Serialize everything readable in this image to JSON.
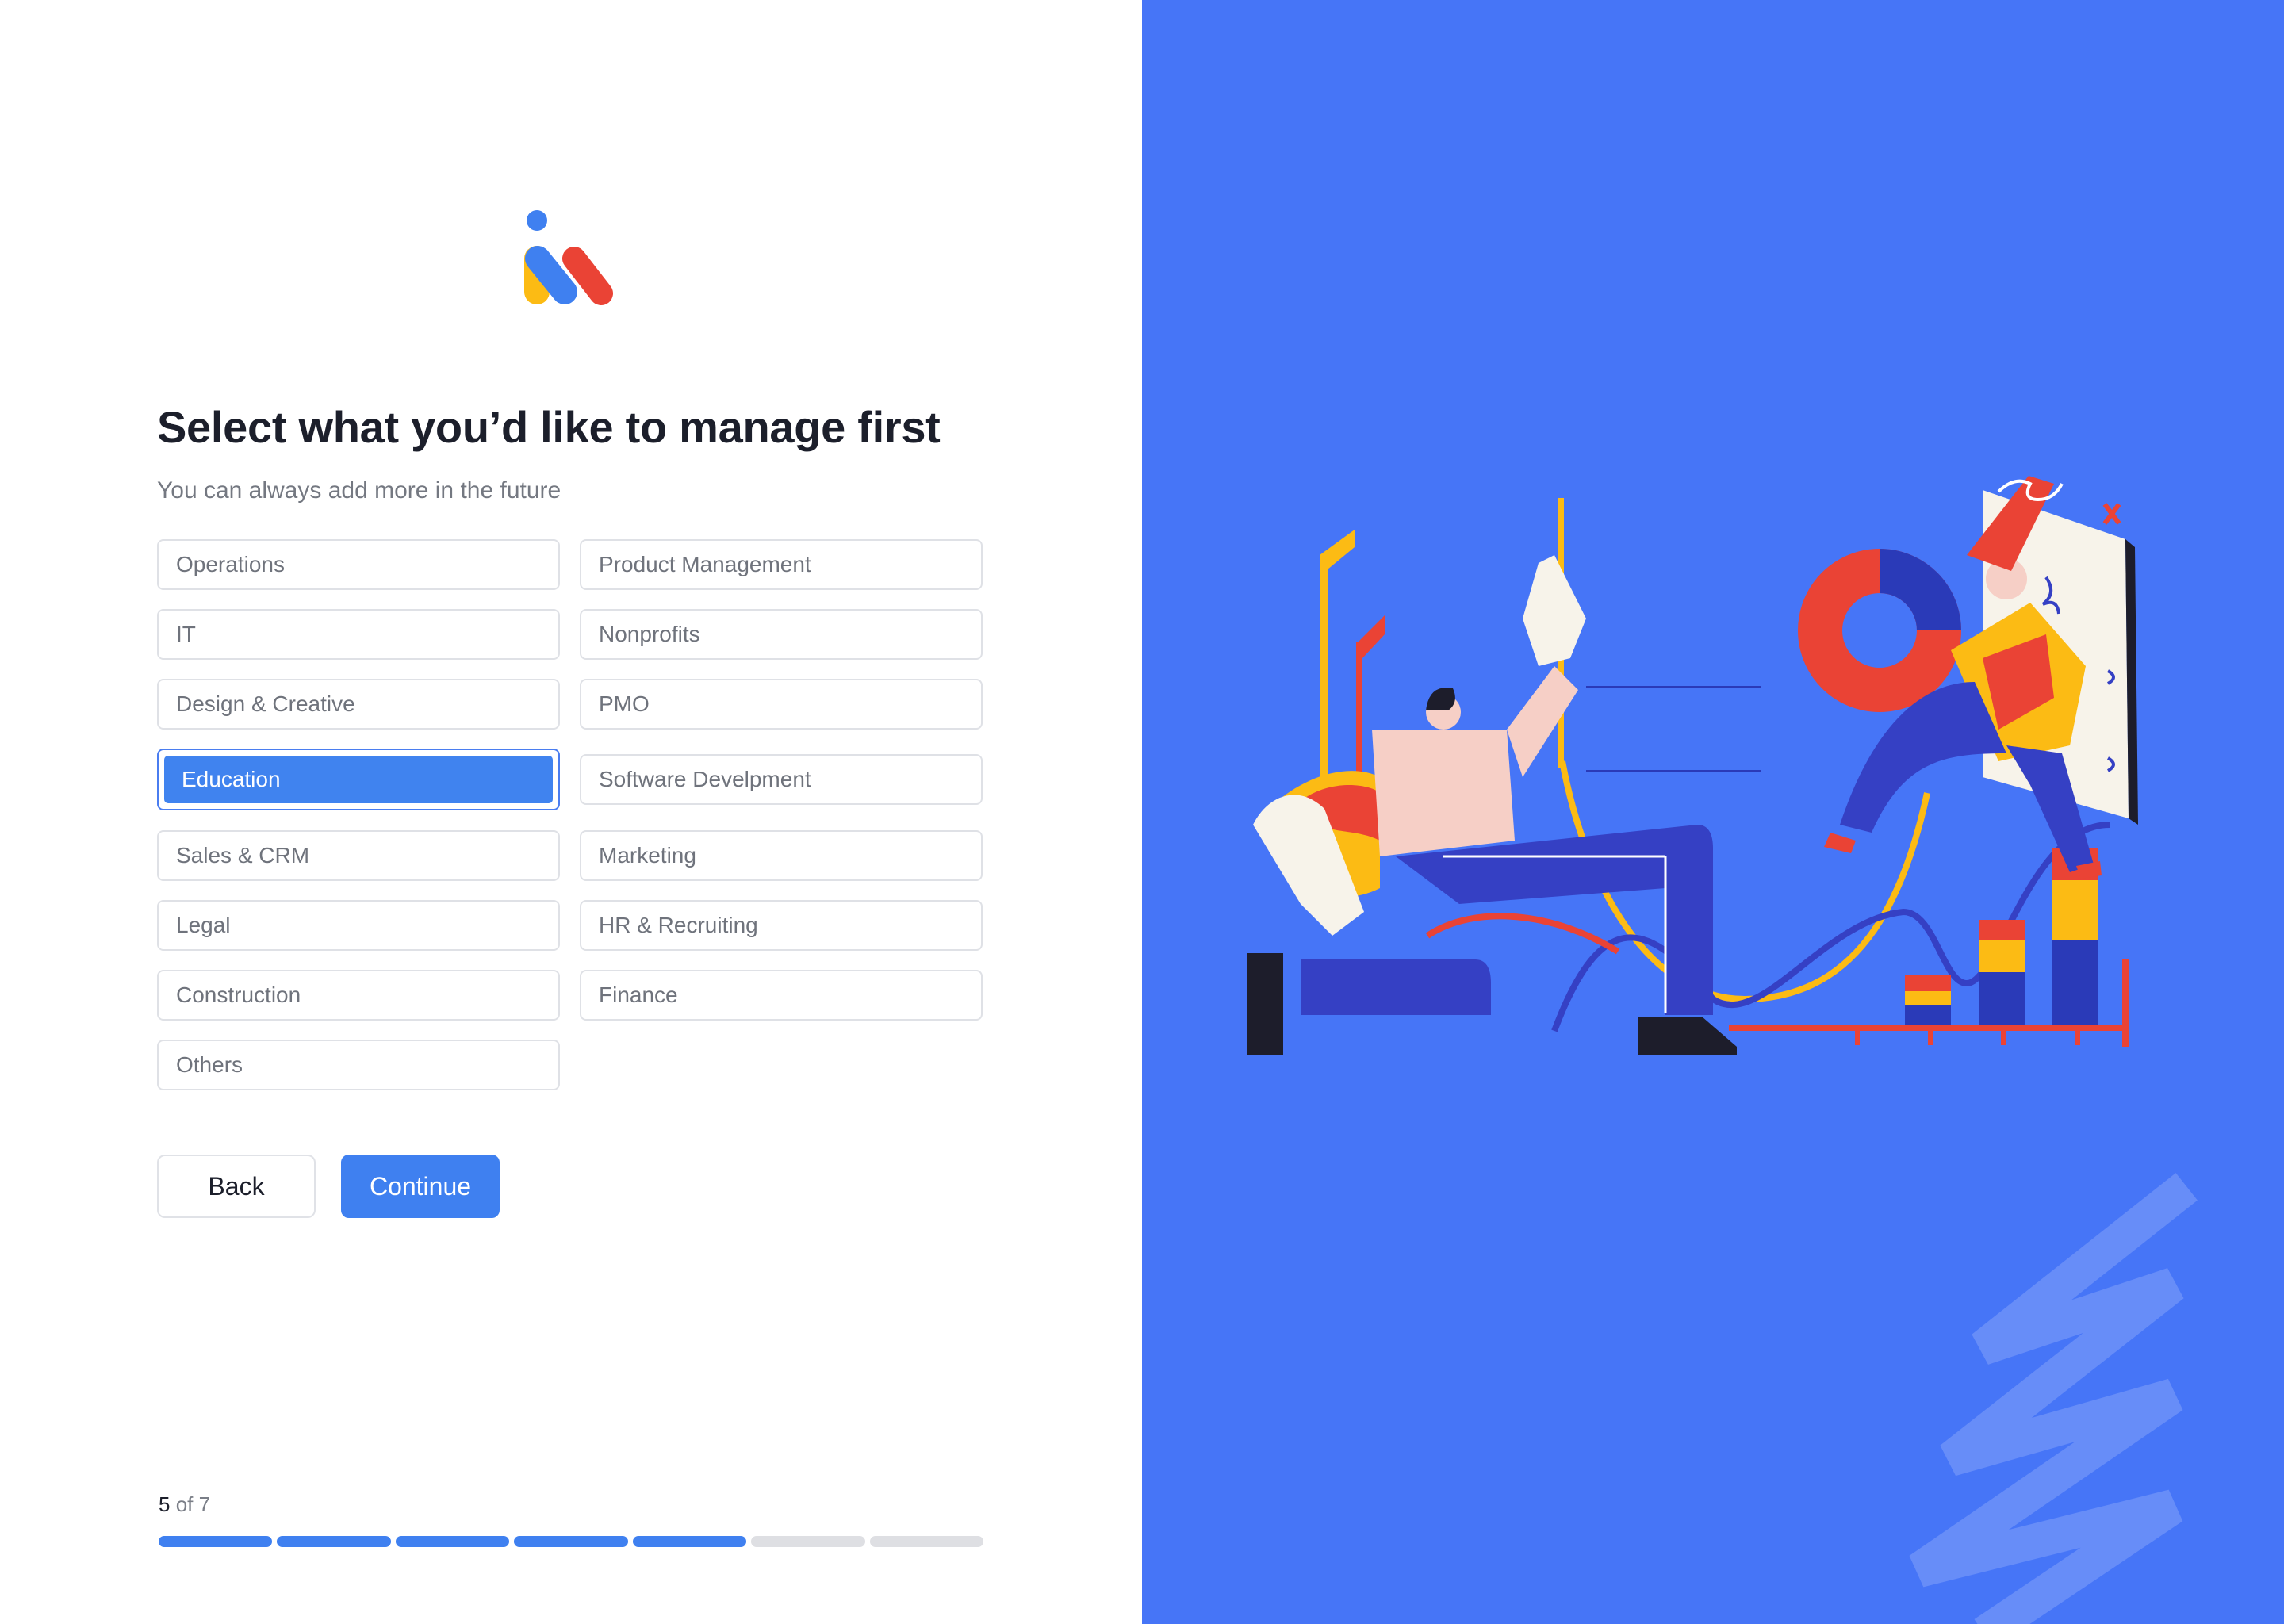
{
  "header": {
    "title": "Select what you’d like to manage first",
    "subtitle": "You can always add more in the future"
  },
  "options": [
    {
      "label": "Operations",
      "selected": false
    },
    {
      "label": "Product Management",
      "selected": false
    },
    {
      "label": "IT",
      "selected": false
    },
    {
      "label": "Nonprofits",
      "selected": false
    },
    {
      "label": "Design & Creative",
      "selected": false
    },
    {
      "label": "PMO",
      "selected": false
    },
    {
      "label": "Education",
      "selected": true
    },
    {
      "label": "Software Develpment",
      "selected": false
    },
    {
      "label": "Sales & CRM",
      "selected": false
    },
    {
      "label": "Marketing",
      "selected": false
    },
    {
      "label": "Legal",
      "selected": false
    },
    {
      "label": "HR & Recruiting",
      "selected": false
    },
    {
      "label": "Construction",
      "selected": false
    },
    {
      "label": "Finance",
      "selected": false
    },
    {
      "label": "Others",
      "selected": false
    }
  ],
  "buttons": {
    "back": "Back",
    "continue": "Continue"
  },
  "progress": {
    "current": "5",
    "of_label": "of 7",
    "completed_steps": 5,
    "total_steps": 7
  },
  "colors": {
    "accent": "#3f80f0",
    "panel": "#4675f7",
    "logo_yellow": "#fcbb14",
    "logo_blue": "#3f80f0",
    "logo_red": "#ea4335"
  }
}
